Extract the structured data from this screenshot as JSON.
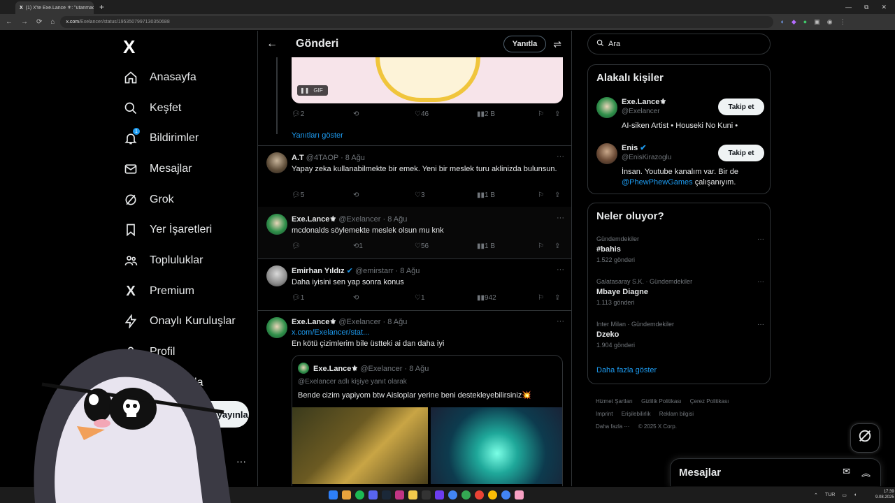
{
  "browser": {
    "tab_title": "(1) X'te Exe.Lance ⚜: \"utanmadan...",
    "new_tab": "+",
    "url_host": "x.com",
    "url_path": "/Exelancer/status/1953507997130350688",
    "win_controls": [
      "—",
      "⧉",
      "✕"
    ]
  },
  "nav": {
    "logo": "X",
    "notif_badge": "1",
    "items": [
      {
        "label": "Anasayfa",
        "icon": "home-icon"
      },
      {
        "label": "Keşfet",
        "icon": "search-icon"
      },
      {
        "label": "Bildirimler",
        "icon": "bell-icon"
      },
      {
        "label": "Mesajlar",
        "icon": "mail-icon"
      },
      {
        "label": "Grok",
        "icon": "grok-icon"
      },
      {
        "label": "Yer İşaretleri",
        "icon": "bookmark-icon"
      },
      {
        "label": "Topluluklar",
        "icon": "people-icon"
      },
      {
        "label": "Premium",
        "icon": "x-icon"
      },
      {
        "label": "Onaylı Kuruluşlar",
        "icon": "bolt-icon"
      },
      {
        "label": "Profil",
        "icon": "user-icon"
      },
      {
        "label": "Daha fazla",
        "icon": "more-icon"
      }
    ],
    "post_button": "Gönderi yayınla",
    "more_dots": "···"
  },
  "main": {
    "back": "←",
    "title": "Gönderi",
    "reply_button": "Yanıtla",
    "gif_label": "GIF",
    "first_actions": {
      "replies": "2",
      "retweets": "",
      "likes": "46",
      "views": "2 B"
    },
    "show_replies": "Yanıtları göster",
    "tweets": [
      {
        "name": "A.T",
        "handle": "@4TAOP · 8 Ağu",
        "text": "Yapay zeka kullanabilmekte bir emek. Yeni bir meslek turu aklinizda bulunsun.",
        "replies": "5",
        "retweets": "",
        "likes": "3",
        "views": "1 B"
      },
      {
        "name": "Exe.Lance⚜",
        "handle": "@Exelancer · 8 Ağu",
        "text": "mcdonalds söylemekte meslek olsun mu knk",
        "replies": "",
        "retweets": "1",
        "likes": "56",
        "views": "1 B"
      },
      {
        "name": "Emirhan Yıldız",
        "handle": "@emirstarr · 8 Ağu",
        "text": "Daha iyisini sen yap sonra konus",
        "replies": "1",
        "retweets": "",
        "likes": "1",
        "views": "942"
      },
      {
        "name": "Exe.Lance⚜",
        "handle": "@Exelancer · 8 Ağu",
        "link": "x.com/Exelancer/stat...",
        "text": "En kötü çizimlerim bile üstteki ai dan daha iyi"
      }
    ],
    "quote": {
      "name": "Exe.Lance⚜",
      "handle": "@Exelancer · 8 Ağu",
      "reply_to": "@Exelancer adlı kişiye yanıt olarak",
      "text": "Bende cizim yapiyom btw Aisloplar yerine beni destekleyebilirsiniz💥"
    }
  },
  "right": {
    "search_placeholder": "Ara",
    "relevant_title": "Alakalı kişiler",
    "people": [
      {
        "name": "Exe.Lance⚜",
        "handle": "@Exelancer",
        "bio": "AI-siken Artist • Houseki No Kuni •",
        "follow": "Takip et"
      },
      {
        "name": "Enis",
        "handle": "@EnisKirazoglu",
        "bio_pre": "İnsan. Youtube kanalım var. Bir de ",
        "bio_link": "@PhewPhewGames",
        "bio_post": " çalışanıyım.",
        "follow": "Takip et"
      }
    ],
    "trends_title": "Neler oluyor?",
    "trends": [
      {
        "category": "Gündemdekiler",
        "name": "#bahis",
        "count": "1.522 gönderi"
      },
      {
        "category": "Galatasaray S.K. · Gündemdekiler",
        "name": "Mbaye Diagne",
        "count": "1.113 gönderi"
      },
      {
        "category": "Inter Milan · Gündemdekiler",
        "name": "Dzeko",
        "count": "1.904 gönderi"
      }
    ],
    "show_more": "Daha fazla göster",
    "footer_links": [
      "Hizmet Şartları",
      "Gizlilik Politikası",
      "Çerez Politikası",
      "Imprint",
      "Erişilebilirlik",
      "Reklam bilgisi",
      "Daha fazla ···",
      "© 2025 X Corp."
    ]
  },
  "messages_drawer": {
    "title": "Mesajlar"
  },
  "taskbar": {
    "lang": "TUR",
    "time": "17:39",
    "date": "9.08.2025"
  }
}
